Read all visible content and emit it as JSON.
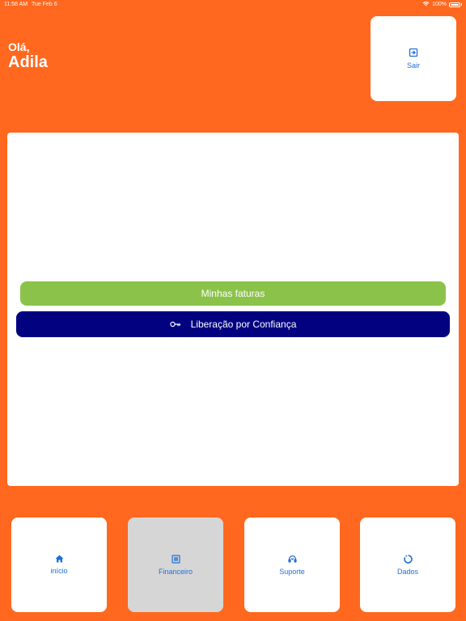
{
  "status_bar": {
    "time": "11:58 AM",
    "date": "Tue Feb 6",
    "battery": "100%"
  },
  "header": {
    "greeting": "Olá,",
    "username": "Adila"
  },
  "logout": {
    "label": "Sair",
    "icon": "logout-icon"
  },
  "actions": {
    "invoices_label": "Minhas faturas",
    "trust_label": "Liberação por Confiança",
    "trust_icon": "key-icon"
  },
  "tabs": [
    {
      "label": "início",
      "icon": "home-icon"
    },
    {
      "label": "Financeiro",
      "icon": "document-icon",
      "active": true
    },
    {
      "label": "Suporte",
      "icon": "support-icon"
    },
    {
      "label": "Dados",
      "icon": "data-icon"
    }
  ],
  "colors": {
    "background": "#ff681e",
    "primary_blue": "#1e6fd9",
    "invoices_button": "#8bc34a",
    "trust_button": "#020281",
    "active_tab": "#d6d6d6"
  }
}
